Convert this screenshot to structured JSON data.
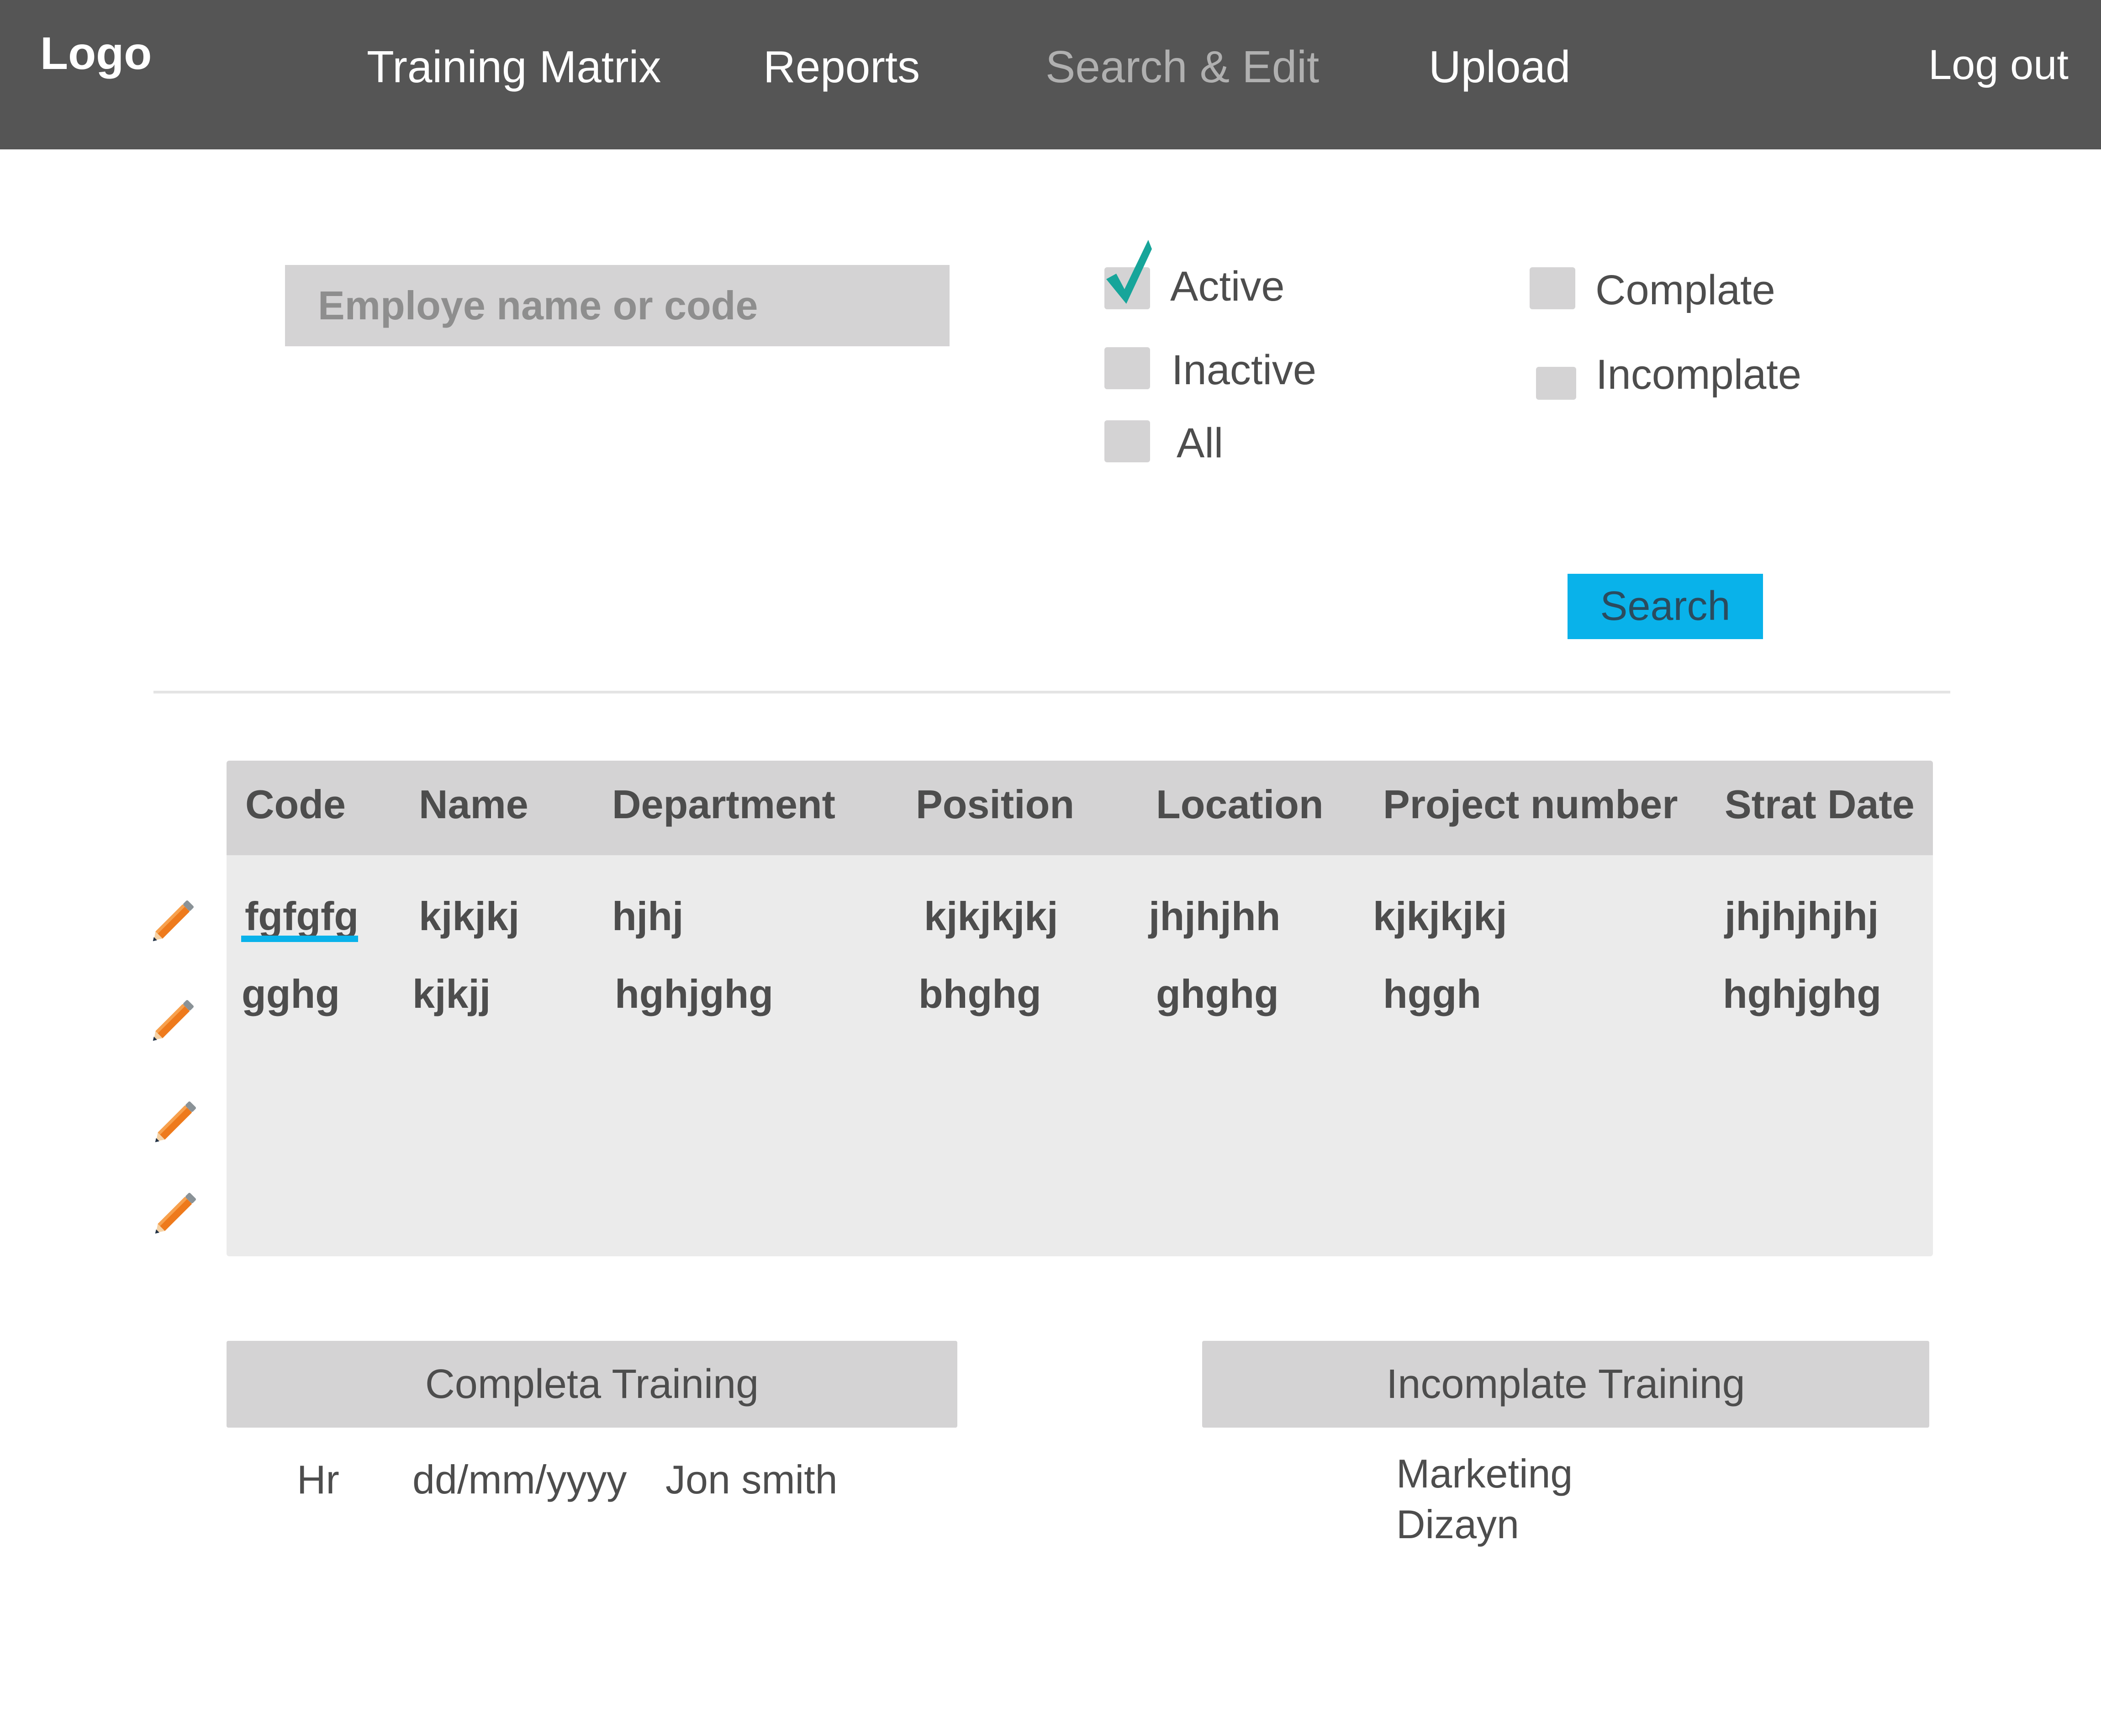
{
  "header": {
    "logo": "Logo",
    "nav": [
      "Training Matrix",
      "Reports",
      "Search & Edit",
      "Upload"
    ],
    "active_nav": "Search & Edit",
    "logout": "Log out"
  },
  "search": {
    "placeholder": "Employe name or code",
    "button_label": "Search"
  },
  "filters": {
    "status": [
      {
        "label": "Active",
        "checked": true
      },
      {
        "label": "Inactive",
        "checked": false
      },
      {
        "label": "All",
        "checked": false
      }
    ],
    "completion": [
      {
        "label": "Complate",
        "checked": false
      },
      {
        "label": "Incomplate",
        "checked": false
      }
    ]
  },
  "table": {
    "columns": [
      "Code",
      "Name",
      "Department",
      "Position",
      "Location",
      "Project number",
      "Strat Date"
    ],
    "rows": [
      [
        "fgfgfg",
        "kjkjkj",
        "hjhj",
        "kjkjkjkj",
        "jhjhjhh",
        "kjkjkjkj",
        "jhjhjhjhj"
      ],
      [
        "gghg",
        "kjkjj",
        "hghjghg",
        "bhghg",
        "ghghg",
        "hggh",
        "hghjghg"
      ]
    ]
  },
  "complete_training": {
    "title": "Completa Training",
    "row": [
      "Hr",
      "dd/mm/yyyy",
      "Jon smith"
    ]
  },
  "incomplete_training": {
    "title": "Incomplate Training",
    "items": [
      "Marketing",
      "Dizayn"
    ]
  },
  "colors": {
    "header_bg": "#555555",
    "accent": "#09b2ea",
    "check": "#17a59a",
    "control_gray": "#d4d3d4"
  },
  "icons": {
    "edit": "pencil-icon",
    "check": "checkmark-icon"
  }
}
